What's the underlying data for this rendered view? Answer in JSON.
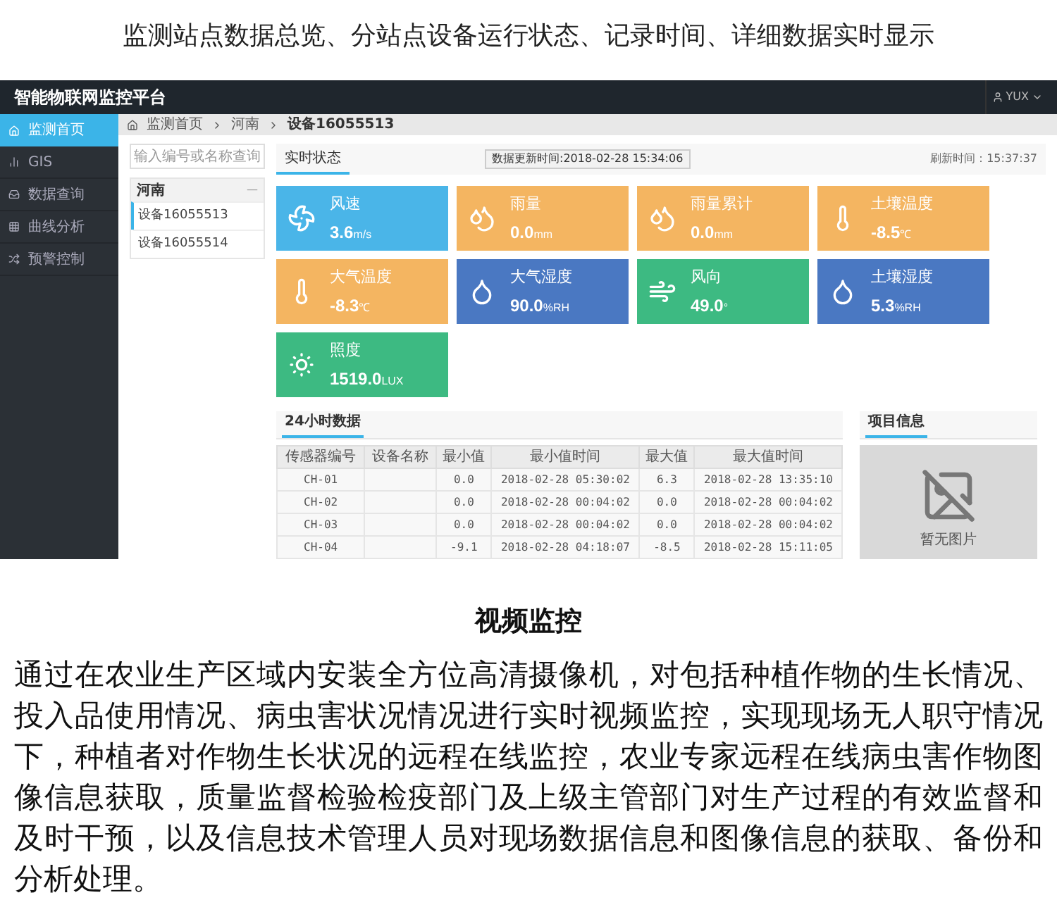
{
  "page_heading": "监测站点数据总览、分站点设备运行状态、记录时间、详细数据实时显示",
  "app": {
    "title": "智能物联网监控平台",
    "user": "YUX",
    "sidebar": [
      {
        "label": "监测首页",
        "kind": "home",
        "selected": true
      },
      {
        "label": "GIS",
        "kind": "signal",
        "selected": false
      },
      {
        "label": "数据查询",
        "kind": "inbox",
        "selected": false
      },
      {
        "label": "曲线分析",
        "kind": "chart",
        "selected": false
      },
      {
        "label": "预警控制",
        "kind": "shuffle",
        "selected": false
      }
    ],
    "breadcrumb": [
      "监测首页",
      "河南",
      "设备16055513"
    ],
    "search": {
      "placeholder": "输入编号或名称查询"
    },
    "device_group": {
      "name": "河南",
      "collapse": "—",
      "devices": [
        {
          "label": "设备16055513",
          "selected": true
        },
        {
          "label": "设备16055514",
          "selected": false
        }
      ]
    },
    "tabs": [
      {
        "label": "实时状态",
        "selected": true
      }
    ],
    "update_time": "数据更新时间:2018-02-28 15:34:06",
    "refresh_time": "刷新时间：15:37:37",
    "sensors": [
      {
        "name": "风速",
        "value": "3.6",
        "unit": "m/s",
        "kind": "fan",
        "color": "#4ab5e8"
      },
      {
        "name": "雨量",
        "value": "0.0",
        "unit": "mm",
        "kind": "rain",
        "color": "#f4b561"
      },
      {
        "name": "雨量累计",
        "value": "0.0",
        "unit": "mm",
        "kind": "rain",
        "color": "#f4b561"
      },
      {
        "name": "土壤温度",
        "value": "-8.5",
        "unit": "℃",
        "kind": "temp",
        "color": "#f4b561"
      },
      {
        "name": "大气温度",
        "value": "-8.3",
        "unit": "℃",
        "kind": "temp",
        "color": "#f4b561"
      },
      {
        "name": "大气湿度",
        "value": "90.0",
        "unit": "%RH",
        "kind": "humidity",
        "color": "#4a78c2"
      },
      {
        "name": "风向",
        "value": "49.0",
        "unit": "°",
        "kind": "windsock",
        "color": "#3dba82"
      },
      {
        "name": "土壤湿度",
        "value": "5.3",
        "unit": "%RH",
        "kind": "humidity",
        "color": "#4a78c2"
      },
      {
        "name": "照度",
        "value": "1519.0",
        "unit": "LUX",
        "kind": "sun",
        "color": "#3dba82"
      }
    ],
    "table": {
      "title": "24小时数据",
      "columns": [
        "传感器编号",
        "设备名称",
        "最小值",
        "最小值时间",
        "最大值",
        "最大值时间"
      ],
      "rows": [
        [
          "CH-01",
          "",
          "0.0",
          "2018-02-28 05:30:02",
          "6.3",
          "2018-02-28 13:35:10"
        ],
        [
          "CH-02",
          "",
          "0.0",
          "2018-02-28 00:04:02",
          "0.0",
          "2018-02-28 00:04:02"
        ],
        [
          "CH-03",
          "",
          "0.0",
          "2018-02-28 00:04:02",
          "0.0",
          "2018-02-28 00:04:02"
        ],
        [
          "CH-04",
          "",
          "-9.1",
          "2018-02-28 04:18:07",
          "-8.5",
          "2018-02-28 15:11:05"
        ]
      ]
    },
    "project": {
      "title": "项目信息",
      "no_image": "暂无图片"
    }
  },
  "section_title": "视频监控",
  "section_text": "通过在农业生产区域内安装全方位高清摄像机，对包括种植作物的生长情况、投入品使用情况、病虫害状况情况进行实时视频监控，实现现场无人职守情况下，种植者对作物生长状况的远程在线监控，农业专家远程在线病虫害作物图像信息获取，质量监督检验检疫部门及上级主管部门对生产过程的有效监督和及时干预，以及信息技术管理人员对现场数据信息和图像信息的获取、备份和分析处理。"
}
